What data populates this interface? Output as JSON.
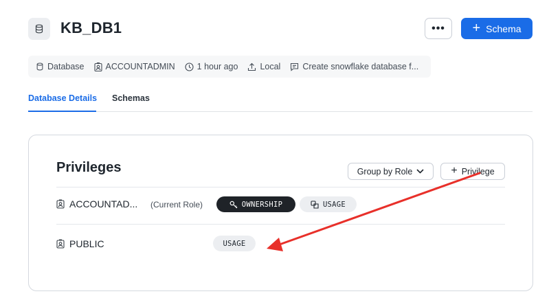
{
  "header": {
    "title": "KB_DB1",
    "more_label": "•••",
    "schema_button_label": "Schema"
  },
  "meta": {
    "type": "Database",
    "owner": "ACCOUNTADMIN",
    "time": "1 hour ago",
    "location": "Local",
    "comment": "Create snowflake database f..."
  },
  "tabs": [
    {
      "label": "Database Details",
      "active": true
    },
    {
      "label": "Schemas",
      "active": false
    }
  ],
  "privileges": {
    "title": "Privileges",
    "group_by_label": "Group by Role",
    "add_label": "Privilege",
    "rows": [
      {
        "role": "ACCOUNTAD...",
        "note": "(Current Role)",
        "grants": [
          "OWNERSHIP",
          "USAGE"
        ]
      },
      {
        "role": "PUBLIC",
        "note": "",
        "grants": [
          "USAGE"
        ]
      }
    ]
  },
  "colors": {
    "accent": "#1a6ce7",
    "dark_pill": "#1f2328",
    "light_pill": "#eceef1",
    "annotation_arrow": "#e8302a"
  }
}
